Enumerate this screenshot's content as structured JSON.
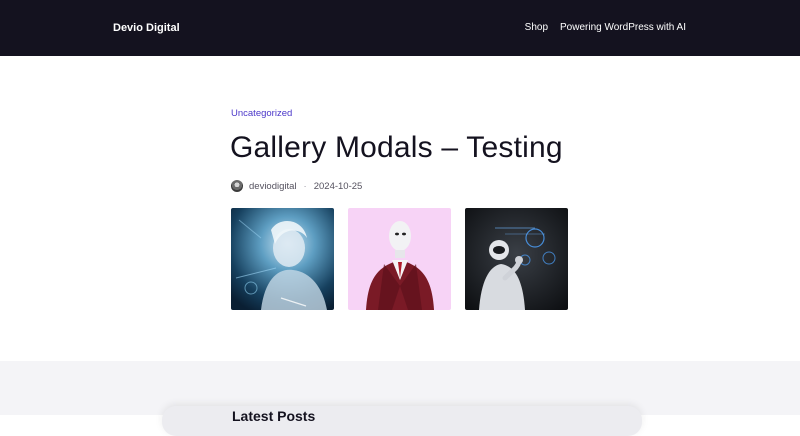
{
  "header": {
    "brand": "Devio Digital",
    "nav": [
      {
        "label": "Shop"
      },
      {
        "label": "Powering WordPress with AI"
      }
    ],
    "background": "#14121f"
  },
  "post": {
    "category": "Uncategorized",
    "title": "Gallery Modals – Testing",
    "author": "deviodigital",
    "separator": "·",
    "date": "2024-10-25",
    "accent": "#4b38c9"
  },
  "gallery": {
    "images": [
      {
        "icon": "woman-hologram-image"
      },
      {
        "icon": "robot-suit-image"
      },
      {
        "icon": "robot-thinking-image"
      }
    ]
  },
  "footer_peek": {
    "heading": "Latest Posts",
    "background": "#f4f4f7"
  }
}
